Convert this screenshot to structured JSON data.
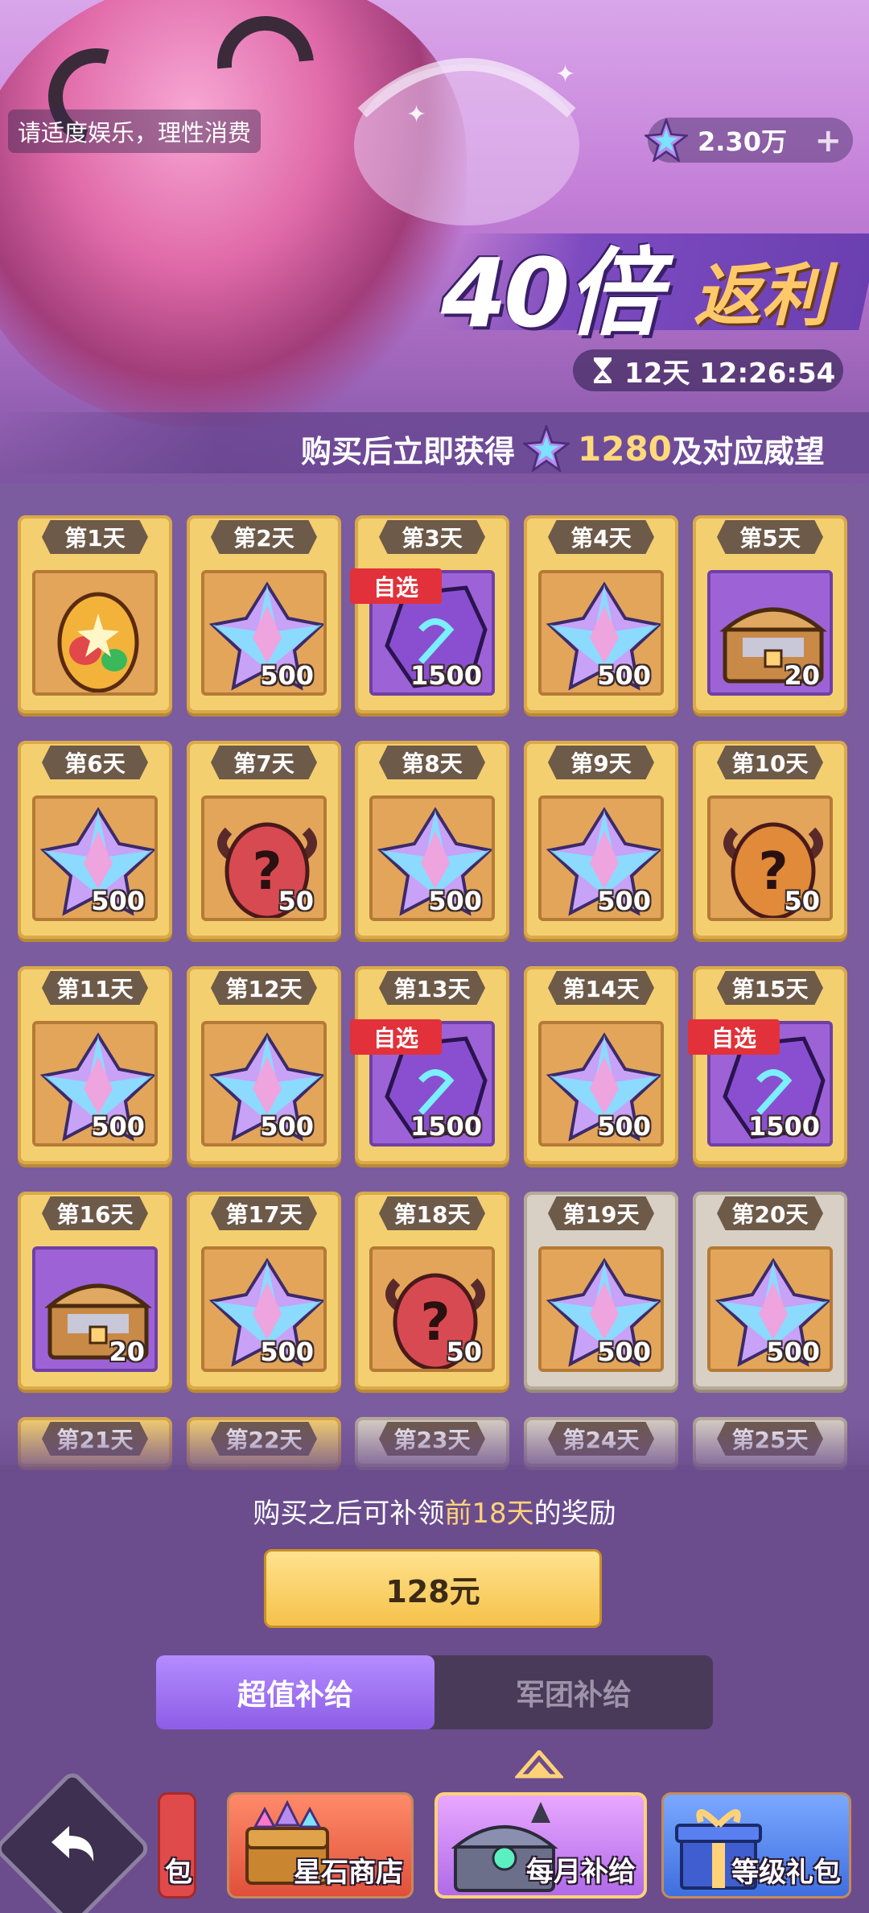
{
  "notice": "请适度娱乐，理性消费",
  "currency": {
    "amount": "2.30万",
    "icon": "star-gem-icon"
  },
  "title": {
    "main": "40倍",
    "accent": "返利"
  },
  "timer": "12天 12:26:54",
  "reward": {
    "prefix": "购买后立即获得",
    "amount": "1280",
    "suffix": "及对应威望"
  },
  "pick_label": "自选",
  "days": [
    {
      "label": "第1天",
      "item": "egg-rainbow",
      "count": "",
      "pick": false,
      "grey": false
    },
    {
      "label": "第2天",
      "item": "crystal",
      "count": "500",
      "pick": false,
      "grey": false
    },
    {
      "label": "第3天",
      "item": "rune-stone",
      "count": "1500",
      "pick": true,
      "grey": false
    },
    {
      "label": "第4天",
      "item": "crystal",
      "count": "500",
      "pick": false,
      "grey": false
    },
    {
      "label": "第5天",
      "item": "chest",
      "count": "20",
      "pick": false,
      "grey": false
    },
    {
      "label": "第6天",
      "item": "crystal",
      "count": "500",
      "pick": false,
      "grey": false
    },
    {
      "label": "第7天",
      "item": "egg-red",
      "count": "50",
      "pick": false,
      "grey": false
    },
    {
      "label": "第8天",
      "item": "crystal",
      "count": "500",
      "pick": false,
      "grey": false
    },
    {
      "label": "第9天",
      "item": "crystal",
      "count": "500",
      "pick": false,
      "grey": false
    },
    {
      "label": "第10天",
      "item": "egg-orange",
      "count": "50",
      "pick": false,
      "grey": false
    },
    {
      "label": "第11天",
      "item": "crystal",
      "count": "500",
      "pick": false,
      "grey": false
    },
    {
      "label": "第12天",
      "item": "crystal",
      "count": "500",
      "pick": false,
      "grey": false
    },
    {
      "label": "第13天",
      "item": "rune-stone",
      "count": "1500",
      "pick": true,
      "grey": false
    },
    {
      "label": "第14天",
      "item": "crystal",
      "count": "500",
      "pick": false,
      "grey": false
    },
    {
      "label": "第15天",
      "item": "rune-stone",
      "count": "1500",
      "pick": true,
      "grey": false
    },
    {
      "label": "第16天",
      "item": "chest",
      "count": "20",
      "pick": false,
      "grey": false
    },
    {
      "label": "第17天",
      "item": "crystal",
      "count": "500",
      "pick": false,
      "grey": false
    },
    {
      "label": "第18天",
      "item": "egg-red",
      "count": "50",
      "pick": false,
      "grey": false
    },
    {
      "label": "第19天",
      "item": "crystal",
      "count": "500",
      "pick": false,
      "grey": true
    },
    {
      "label": "第20天",
      "item": "crystal",
      "count": "500",
      "pick": false,
      "grey": true
    },
    {
      "label": "第21天",
      "item": "",
      "count": "",
      "pick": false,
      "grey": false
    },
    {
      "label": "第22天",
      "item": "",
      "count": "",
      "pick": false,
      "grey": false
    },
    {
      "label": "第23天",
      "item": "",
      "count": "",
      "pick": false,
      "grey": true
    },
    {
      "label": "第24天",
      "item": "",
      "count": "",
      "pick": false,
      "grey": true
    },
    {
      "label": "第25天",
      "item": "",
      "count": "",
      "pick": false,
      "grey": true
    }
  ],
  "hint": {
    "prefix": "购买之后可补领",
    "highlight": "前18天",
    "suffix": "的奖励"
  },
  "price": "128元",
  "tabs": [
    {
      "label": "超值补给",
      "active": true
    },
    {
      "label": "军团补给",
      "active": false
    }
  ],
  "nav": [
    {
      "label": "包",
      "icon": "gift-icon"
    },
    {
      "label": "星石商店",
      "icon": "gem-chest-icon"
    },
    {
      "label": "每月补给",
      "icon": "monthly-chest-icon",
      "active": true
    },
    {
      "label": "等级礼包",
      "icon": "level-gift-icon"
    }
  ],
  "colors": {
    "accent": "#8d5de6",
    "gold": "#f5c24a",
    "highlight": "#ffd278",
    "pick": "#e2313a"
  }
}
